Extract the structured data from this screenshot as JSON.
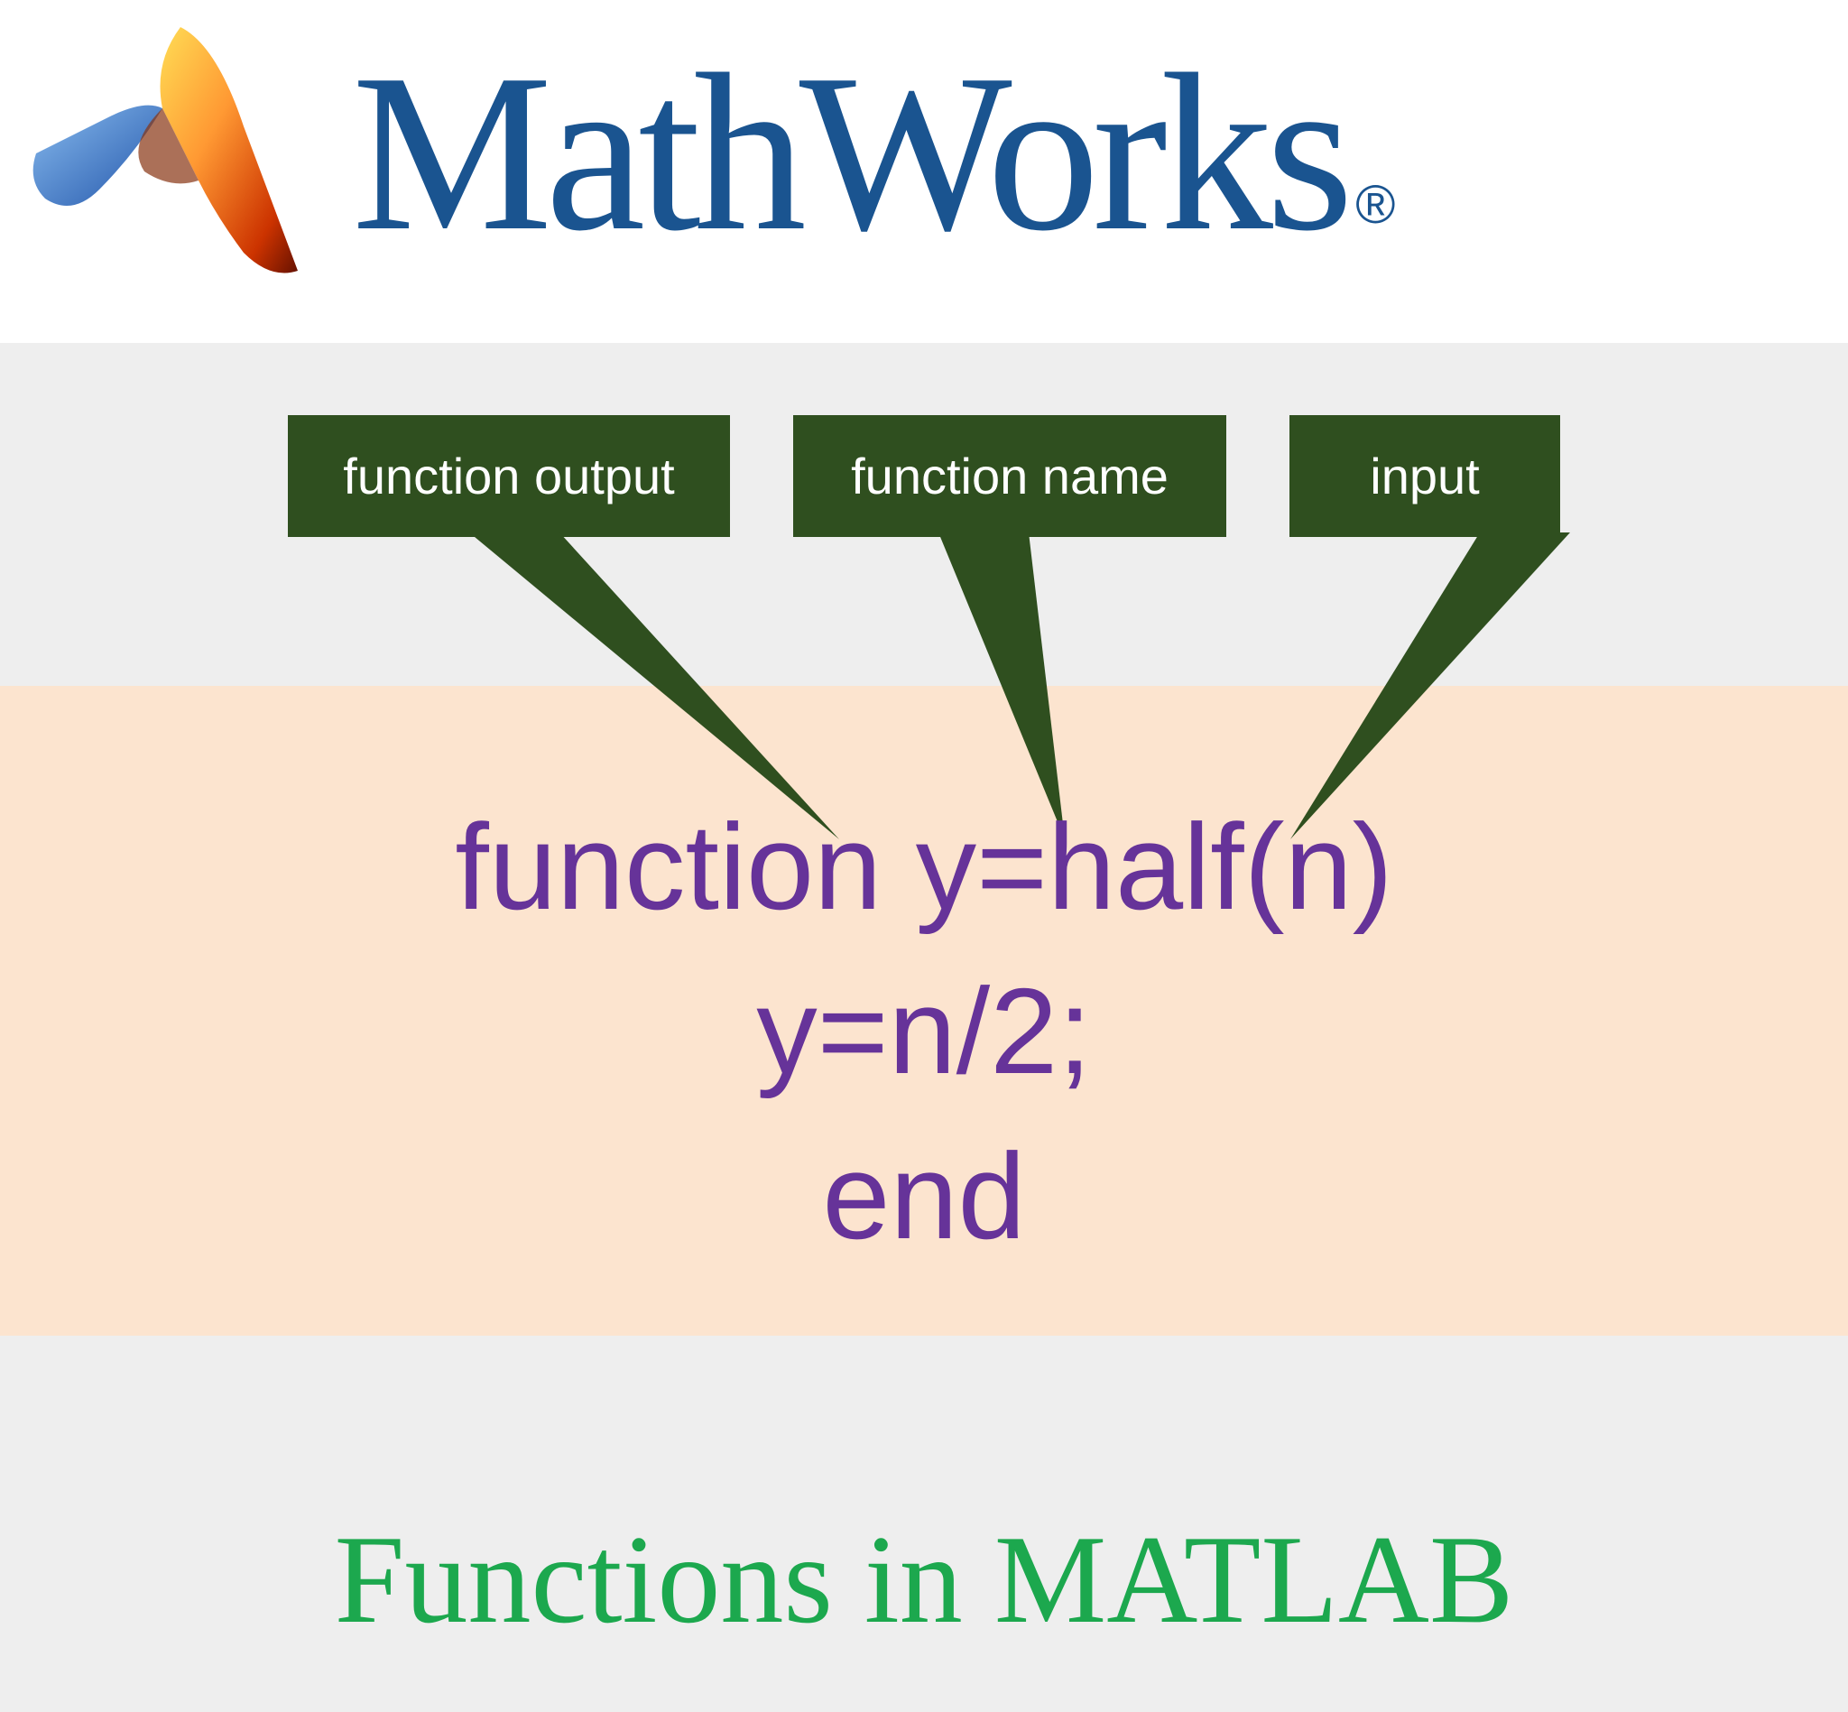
{
  "logo": {
    "company_name": "MathWorks",
    "registered_symbol": "®"
  },
  "callouts": {
    "output": "function output",
    "name": "function name",
    "input": "input"
  },
  "code": {
    "line1": "function y=half(n)",
    "line2": "y=n/2;",
    "line3": "end"
  },
  "title": "Functions in MATLAB",
  "colors": {
    "logo_blue": "#1a5490",
    "callout_green": "#2f4f1f",
    "code_purple": "#663399",
    "title_green": "#1ca84e",
    "gray_bg": "#eeeeee",
    "peach_bg": "#fce4cf"
  }
}
